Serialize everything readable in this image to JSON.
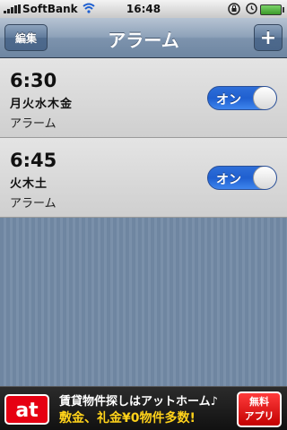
{
  "status_bar": {
    "carrier": "SoftBank",
    "time": "16:48"
  },
  "nav": {
    "edit_label": "編集",
    "title": "アラーム",
    "add_label": "+"
  },
  "alarms": [
    {
      "time": "6:30",
      "days": "月火水木金",
      "label": "アラーム",
      "toggle": "オン"
    },
    {
      "time": "6:45",
      "days": "火木土",
      "label": "アラーム",
      "toggle": "オン"
    }
  ],
  "ad": {
    "logo": "at",
    "line1": "賃貸物件探しはアットホーム♪",
    "line2": "敷金、礼金¥0物件多数!",
    "badge_line1": "無料",
    "badge_line2": "アプリ"
  },
  "colors": {
    "toggle_on": "#2f6fd8",
    "ad_red": "#e60012"
  }
}
